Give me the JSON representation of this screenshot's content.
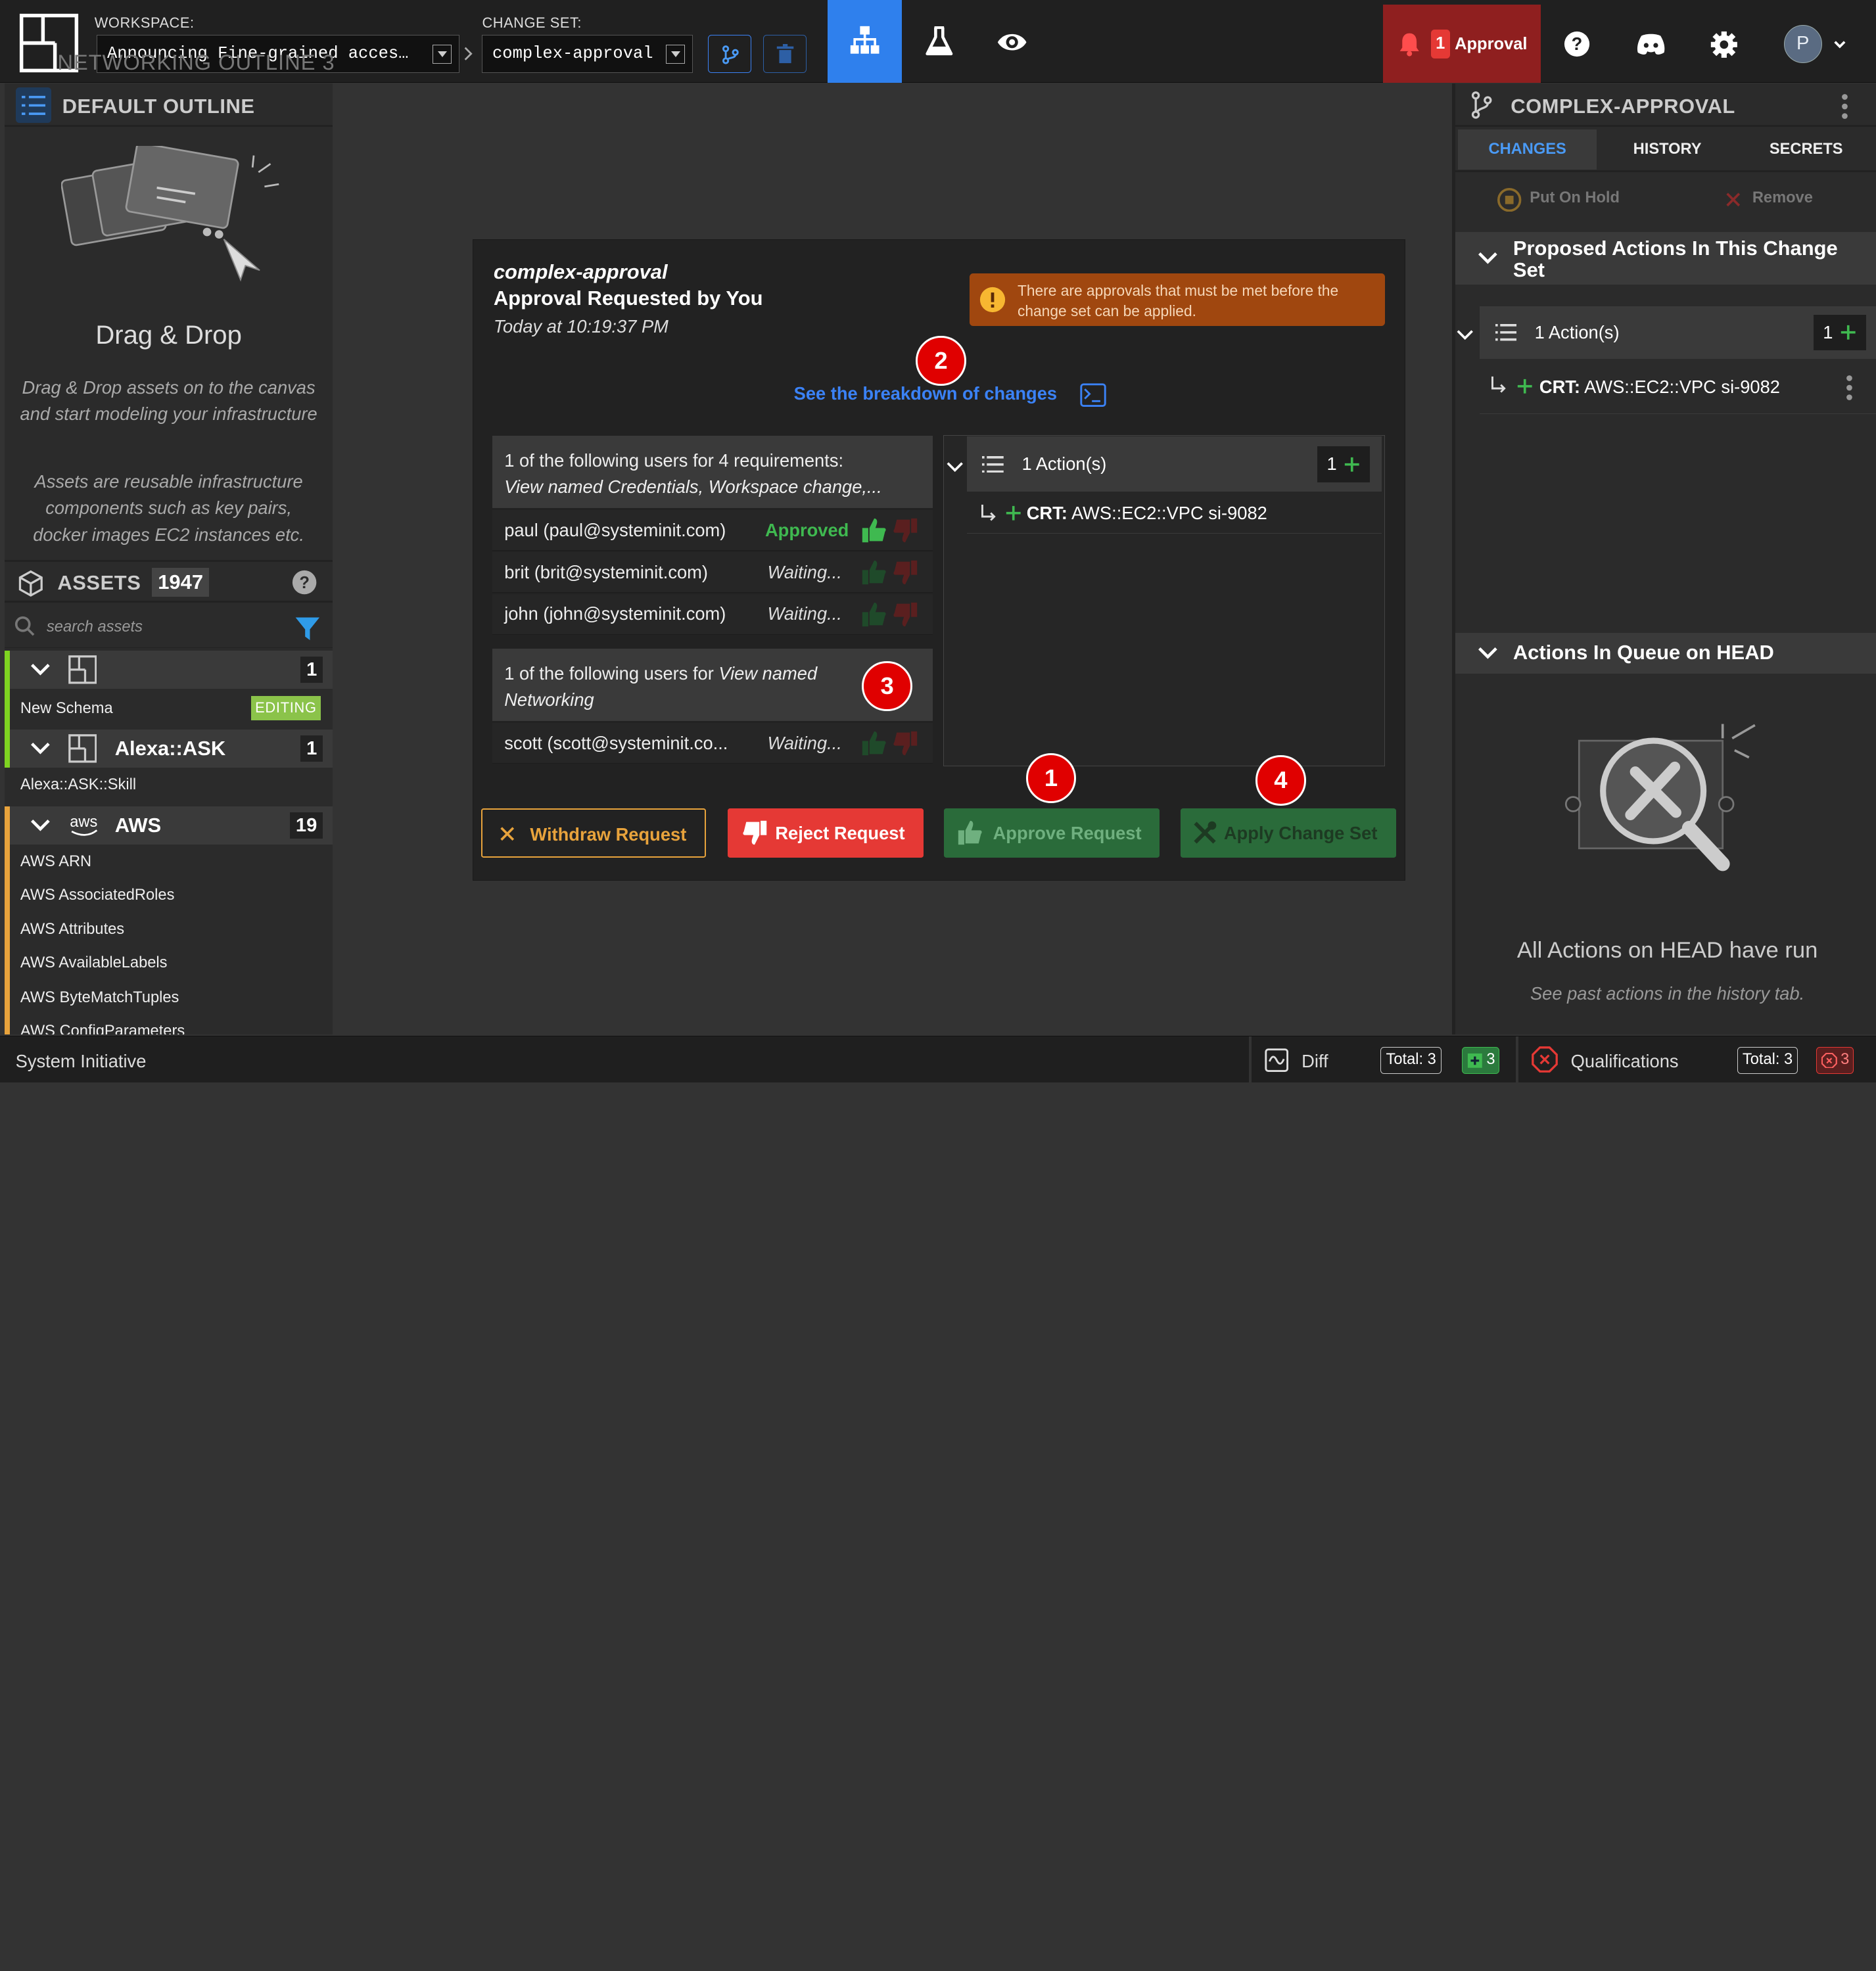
{
  "topbar": {
    "workspace_label": "WORKSPACE:",
    "workspace_value": "Announcing Fine-grained acces…",
    "ghost_text": "NETWORKING OUTLINE 3",
    "changeset_label": "CHANGE SET:",
    "changeset_value": "complex-approval",
    "approval_count": "1",
    "approval_label": "Approval",
    "avatar_initial": "P",
    "colors": {
      "active_tab": "#2f80ed",
      "approval_bg": "#8f1f1f"
    }
  },
  "left": {
    "outline_title": "DEFAULT OUTLINE",
    "dnd_title": "Drag & Drop",
    "dnd_text1": "Drag & Drop assets on to the canvas and start modeling your infrastructure",
    "dnd_text2": "Assets are reusable infrastructure components such as key pairs, docker images EC2 instances etc.",
    "assets_title": "ASSETS",
    "assets_count": "1947",
    "search_placeholder": "search assets",
    "groups": [
      {
        "label": "",
        "count": "1",
        "items": [
          "New Schema"
        ],
        "badge": "EDITING"
      },
      {
        "label": "Alexa::ASK",
        "count": "1",
        "items": [
          "Alexa::ASK::Skill"
        ]
      },
      {
        "label": "AWS",
        "logo": "aws",
        "count": "19",
        "items": [
          "AWS ARN",
          "AWS AssociatedRoles",
          "AWS Attributes",
          "AWS AvailableLabels",
          "AWS ByteMatchTuples",
          "AWS ConfigParameters"
        ]
      }
    ]
  },
  "modal": {
    "changeset_name": "complex-approval",
    "requested": "Approval Requested by You",
    "date": "Today at 10:19:37 PM",
    "warning": "There are approvals that must be met before the change set can be applied.",
    "breakdown_link": "See the breakdown of changes",
    "req1_line1": "1 of the following users for 4 requirements:",
    "req1_line2": "View named Credentials, Workspace change,...",
    "req1_users": [
      {
        "name": "paul (paul@systeminit.com)",
        "status": "Approved"
      },
      {
        "name": "brit (brit@systeminit.com)",
        "status": "Waiting..."
      },
      {
        "name": "john (john@systeminit.com)",
        "status": "Waiting..."
      }
    ],
    "req2_prefix": "1 of the following users for ",
    "req2_italic": "View named",
    "req2_line2": "Networking",
    "req2_users": [
      {
        "name": "scott (scott@systeminit.co...",
        "status": "Waiting..."
      }
    ],
    "actions_label": "1 Action(s)",
    "actions_count": "1",
    "crt_prefix": "CRT:",
    "crt_text": "AWS::EC2::VPC si-9082",
    "buttons": {
      "withdraw": "Withdraw Request",
      "reject": "Reject Request",
      "approve": "Approve Request",
      "apply": "Apply Change Set"
    },
    "badges": [
      "1",
      "2",
      "3",
      "4"
    ]
  },
  "right": {
    "title": "COMPLEX-APPROVAL",
    "tabs": [
      "CHANGES",
      "HISTORY",
      "SECRETS"
    ],
    "put_on_hold": "Put On Hold",
    "remove": "Remove",
    "proposed_title": "Proposed Actions In This Change Set",
    "actions_label": "1 Action(s)",
    "actions_count": "1",
    "crt_prefix": "CRT:",
    "crt_text": "AWS::EC2::VPC si-9082",
    "queue_title": "Actions In Queue on HEAD",
    "empty_title": "All Actions on HEAD have run",
    "empty_sub": "See past actions in the history tab."
  },
  "status": {
    "app_name": "System Initiative",
    "diff_label": "Diff",
    "diff_total": "Total: 3",
    "diff_added": "3",
    "qual_label": "Qualifications",
    "qual_total": "Total: 3",
    "qual_failed": "3"
  }
}
